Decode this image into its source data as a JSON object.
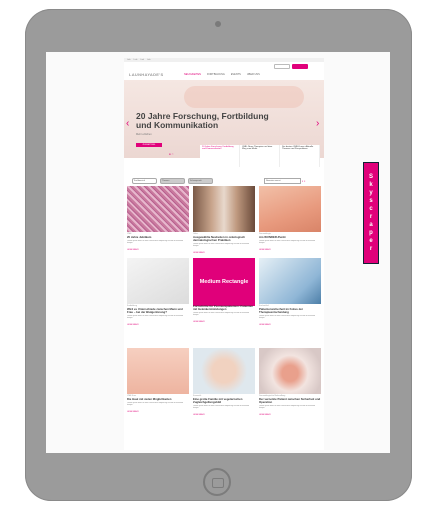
{
  "device": {
    "type": "tablet"
  },
  "site": {
    "logo": "LAUNHAYADE'S",
    "topbar": [
      "Link",
      "Link",
      "Link",
      "Link"
    ],
    "nav": [
      "NEUIGKEITEN",
      "FORTBILDUNG",
      "EVENTS",
      "UBER UNS"
    ],
    "hero": {
      "title": "20 Jahre Forschung, Fortbildung und Kommunikation",
      "subtitle": "Mehr erfahren",
      "button": "ZUM ARTIKEL"
    },
    "teasers": [
      {
        "label": "20 Jahre Forschung, Fortbildung und Kommunikation",
        "active": true
      },
      {
        "label": "CME: Neue Therapien auf dem Weg zum Markt",
        "active": false
      },
      {
        "label": "Die besten CME-Kurse: Aktuelle Themen und Perspektiven",
        "active": false
      }
    ],
    "filters": {
      "chips": [
        "Fachbereich",
        "Themen",
        "Schwerpunkt"
      ],
      "sort": "Neuestes zuerst"
    },
    "cards": [
      {
        "meta": "CME",
        "title": "20 Jahre Jubiläum",
        "text": "Lorem ipsum dolor sit amet consectetur adipiscing elit sed do eiusmod tempor",
        "more": "LESE MEHR"
      },
      {
        "meta": "Onko",
        "title": "Ausgewählte Neuheiten in onkologisch dermatologischen Praktiken",
        "text": "Lorem ipsum dolor sit amet consectetur adipiscing elit sed do eiusmod tempor",
        "more": "LESE MEHR"
      },
      {
        "meta": "Dermatologie",
        "title": "Am WUNDER-Punkt",
        "text": "Lorem ipsum dolor sit amet consectetur adipiscing elit sed do eiusmod tempor",
        "more": "LESE MEHR"
      },
      {
        "meta": "Fortbildung",
        "title": "Wird es Unterschiede zwischen Mann und Frau – bei der Blutgerinnung?",
        "text": "Lorem ipsum dolor sit amet consectetur adipiscing elit sed do eiusmod tempor",
        "more": "LESE MEHR"
      },
      {
        "meta": "Forschung",
        "title": "Fortschritte für Psoriasispatienten: Patienten mit Gelenkentzündungen",
        "text": "Lorem ipsum dolor sit amet consectetur adipiscing elit sed do eiusmod tempor",
        "more": "LESE MEHR"
      },
      {
        "meta": "Fachartikel",
        "title": "Patientensicherheit im Fokus der Therapieentscheidung",
        "text": "Lorem ipsum dolor sit amet consectetur adipiscing elit sed do eiusmod tempor",
        "more": "LESE MEHR"
      },
      {
        "meta": "CME Kurs",
        "title": "Die Haut mit vielen Möglichkeiten",
        "text": "Lorem ipsum dolor sit amet consectetur adipiscing elit sed do eiusmod tempor",
        "more": "LESE MEHR"
      },
      {
        "meta": "Kosmetik",
        "title": "Eine große Familie mit vegetarischen Zugleichgeltungsbild",
        "text": "Lorem ipsum dolor sit amet consectetur adipiscing elit sed do eiusmod tempor",
        "more": "LESE MEHR"
      },
      {
        "meta": "Dermatologische Behandlung",
        "title": "Der vernetzte Patient zwischen Sicherheit und Operation",
        "text": "Lorem ipsum dolor sit amet consectetur adipiscing elit sed do eiusmod tempor",
        "more": "LESE MEHR"
      }
    ]
  },
  "ads": {
    "skyscraper": "Skyscraper",
    "medium_rectangle": "Medium Rectangle"
  },
  "colors": {
    "accent": "#e0007a",
    "frame": "#9b9b9b"
  }
}
